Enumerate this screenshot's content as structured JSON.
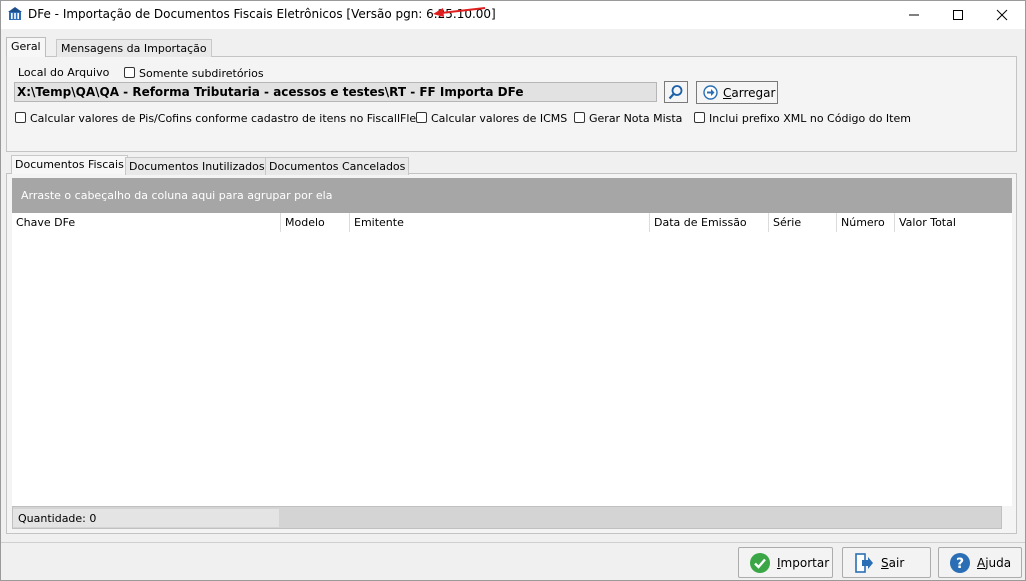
{
  "window": {
    "title": "DFe - Importação de Documentos Fiscais Eletrônicos [Versão pgn: 6.25.10.00]",
    "controls": [
      "minimize-icon",
      "maximize-icon",
      "close-icon"
    ]
  },
  "top_tabs": [
    {
      "label": "Geral",
      "active": true
    },
    {
      "label": "Mensagens da Importação",
      "active": false
    }
  ],
  "geral": {
    "local_label": "Local do Arquivo",
    "somente_subdir_label": "Somente subdiretórios",
    "path_value": "X:\\Temp\\QA\\QA - Reforma Tributaria - acessos e testes\\RT - FF Importa DFe",
    "load_button": {
      "first": "C",
      "rest": "arregar"
    },
    "options": [
      "Calcular valores de Pis/Cofins conforme cadastro de itens  no FiscallFlex",
      "Calcular valores de ICMS",
      "Gerar Nota Mista",
      "Inclui prefixo XML no Código do Item"
    ]
  },
  "doc_tabs": [
    {
      "label": "Documentos Fiscais",
      "active": true
    },
    {
      "label": "Documentos Inutilizados",
      "active": false
    },
    {
      "label": "Documentos Cancelados",
      "active": false
    }
  ],
  "grid": {
    "group_hint": "Arraste o cabeçalho da coluna aqui para agrupar por ela",
    "columns": [
      "Chave DFe",
      "Modelo",
      "Emitente",
      "Data de Emissão",
      "Série",
      "Número",
      "Valor Total"
    ],
    "quantity": "Quantidade: 0"
  },
  "buttons": {
    "importar": {
      "first": "I",
      "rest": "mportar"
    },
    "sair": {
      "first": "S",
      "rest": "air"
    },
    "ajuda": {
      "first": "A",
      "rest": "juda"
    }
  },
  "colors": {
    "accent_red": "#e02020",
    "group_bar": "#a6a6a6",
    "import_green": "#3aa646",
    "help_blue": "#2a6fb5"
  }
}
